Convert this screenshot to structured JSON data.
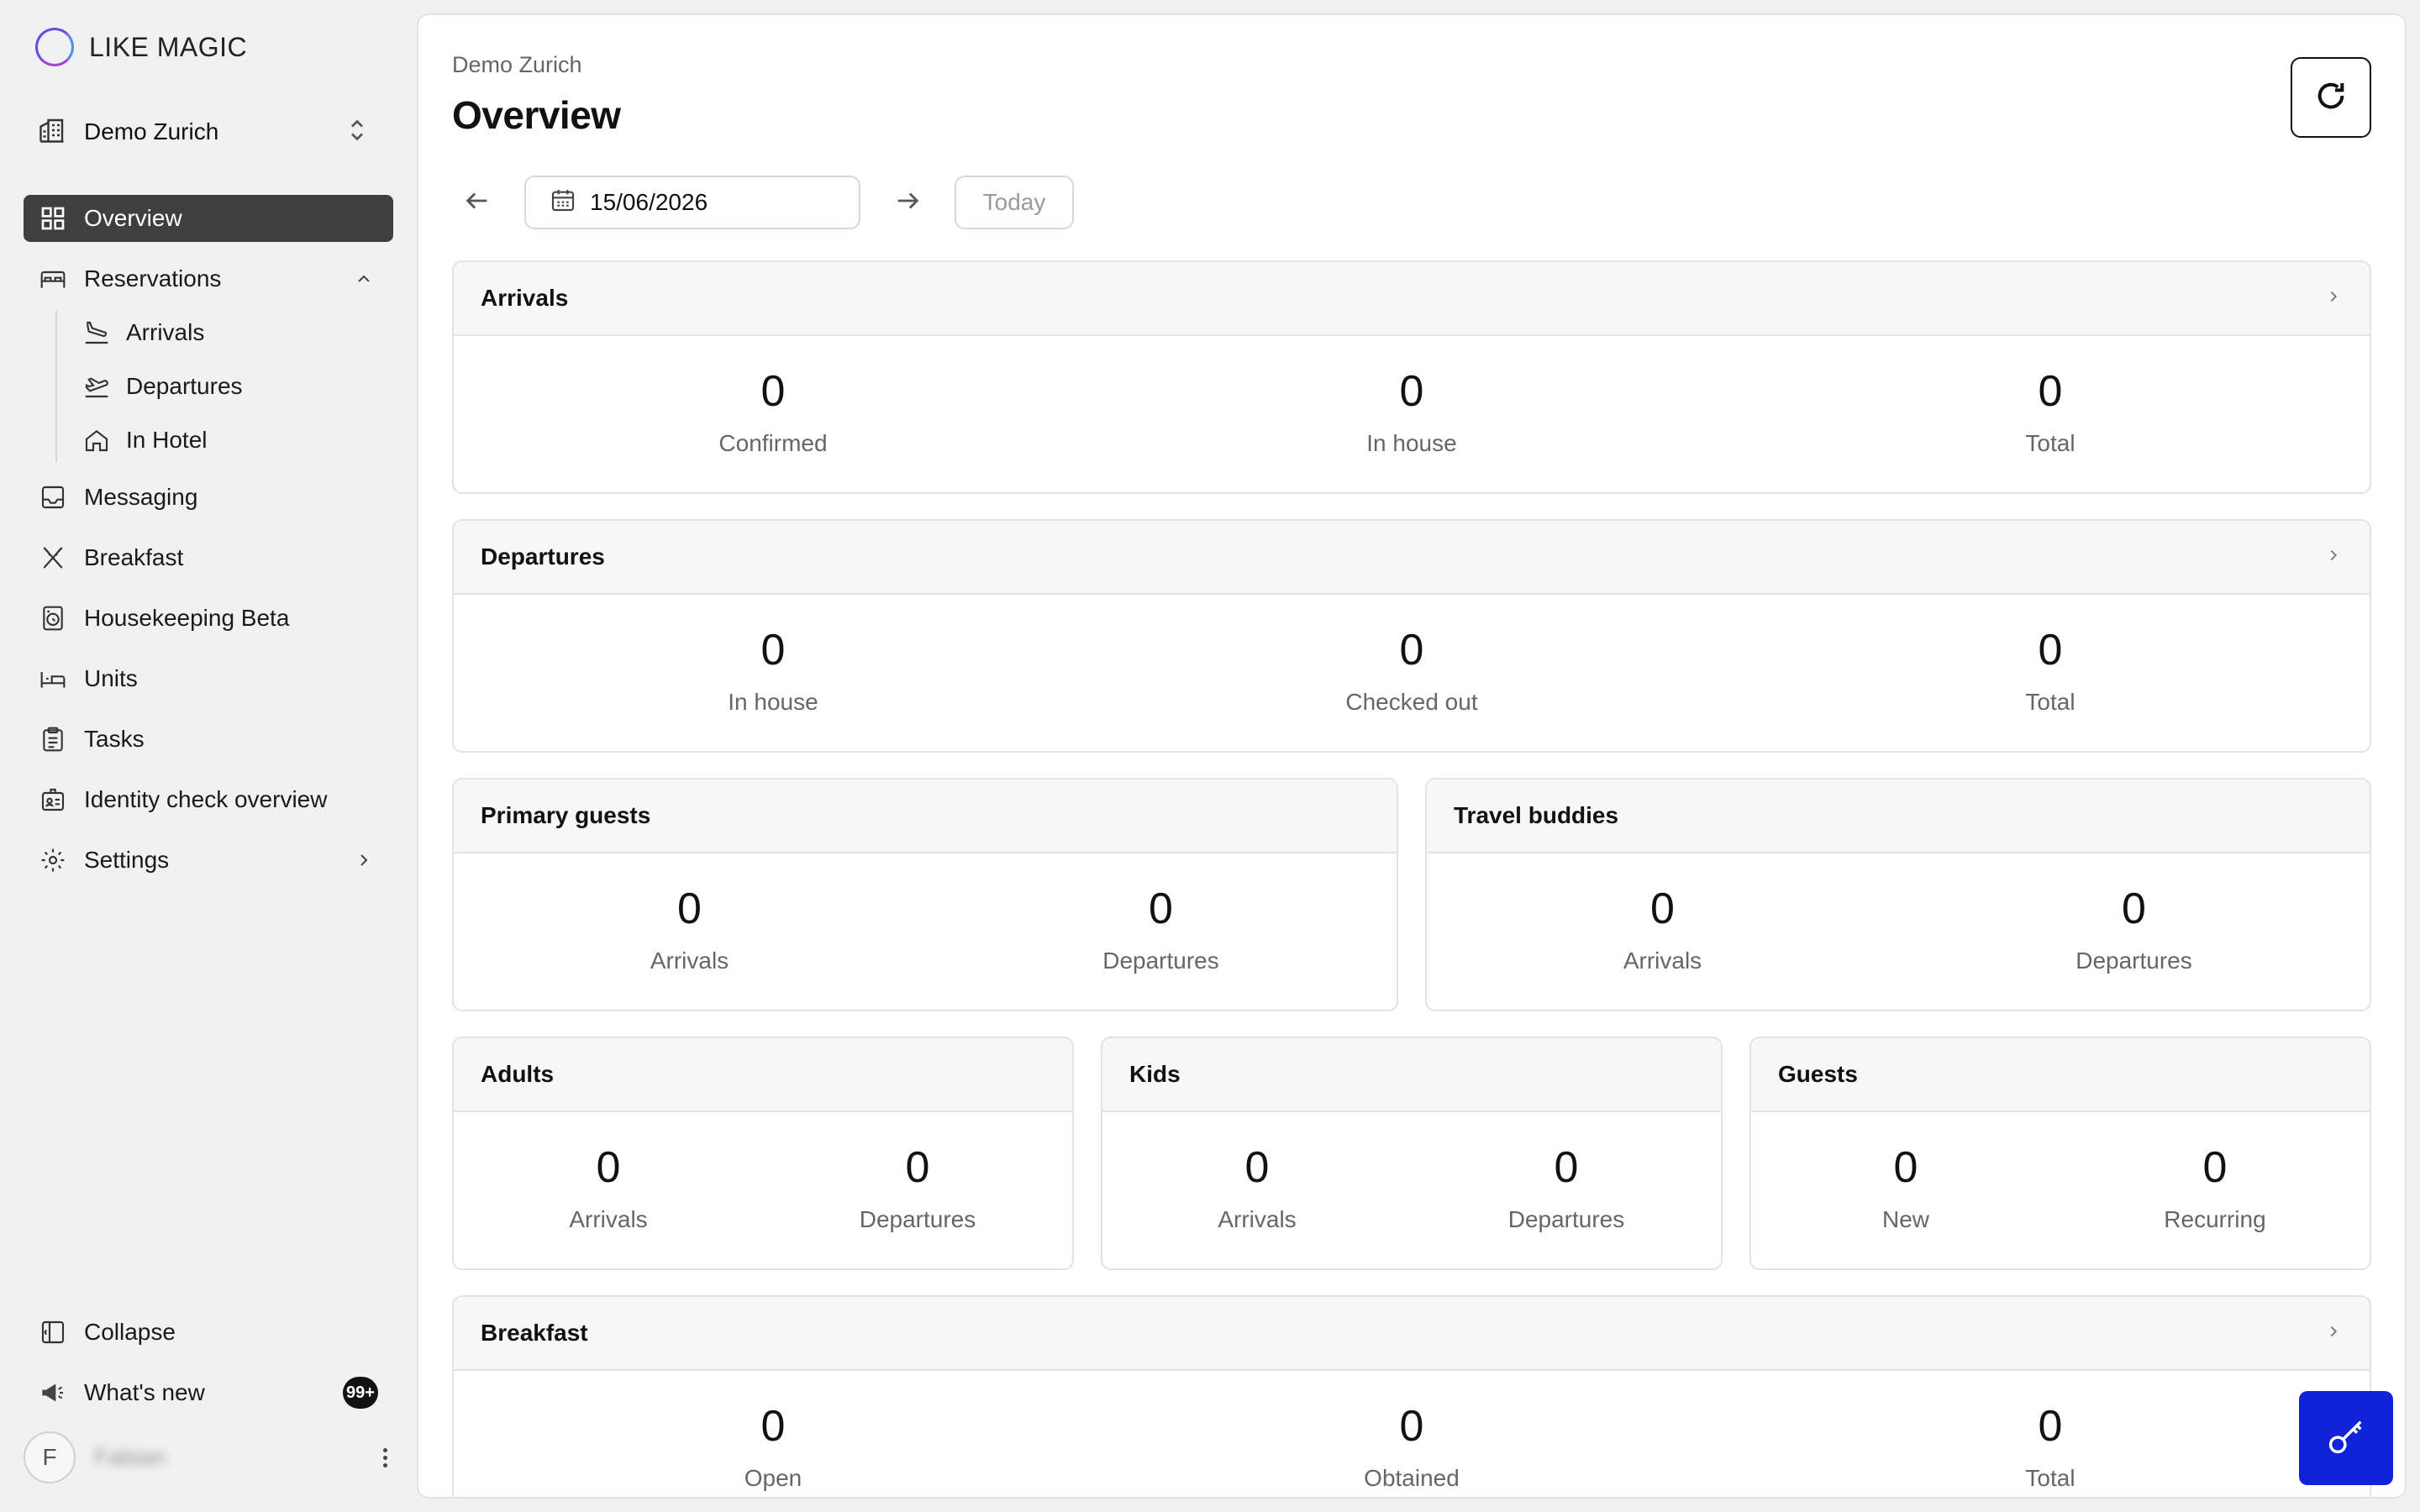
{
  "app": {
    "name": "LIKE MAGIC"
  },
  "property": {
    "name": "Demo Zurich"
  },
  "nav": {
    "overview": "Overview",
    "reservations": "Reservations",
    "arrivals": "Arrivals",
    "departures": "Departures",
    "in_hotel": "In Hotel",
    "messaging": "Messaging",
    "breakfast": "Breakfast",
    "housekeeping": "Housekeeping Beta",
    "units": "Units",
    "tasks": "Tasks",
    "identity": "Identity check overview",
    "settings": "Settings"
  },
  "bottom": {
    "collapse": "Collapse",
    "whats_new": "What's new",
    "badge": "99+",
    "avatar_initial": "F",
    "user_name": "Fabian"
  },
  "header": {
    "breadcrumb": "Demo Zurich",
    "title": "Overview"
  },
  "datebar": {
    "date": "15/06/2026",
    "today": "Today"
  },
  "cards": {
    "arrivals": {
      "title": "Arrivals",
      "stats": [
        {
          "value": "0",
          "label": "Confirmed"
        },
        {
          "value": "0",
          "label": "In house"
        },
        {
          "value": "0",
          "label": "Total"
        }
      ]
    },
    "departures": {
      "title": "Departures",
      "stats": [
        {
          "value": "0",
          "label": "In house"
        },
        {
          "value": "0",
          "label": "Checked out"
        },
        {
          "value": "0",
          "label": "Total"
        }
      ]
    },
    "primary_guests": {
      "title": "Primary guests",
      "stats": [
        {
          "value": "0",
          "label": "Arrivals"
        },
        {
          "value": "0",
          "label": "Departures"
        }
      ]
    },
    "travel_buddies": {
      "title": "Travel buddies",
      "stats": [
        {
          "value": "0",
          "label": "Arrivals"
        },
        {
          "value": "0",
          "label": "Departures"
        }
      ]
    },
    "adults": {
      "title": "Adults",
      "stats": [
        {
          "value": "0",
          "label": "Arrivals"
        },
        {
          "value": "0",
          "label": "Departures"
        }
      ]
    },
    "kids": {
      "title": "Kids",
      "stats": [
        {
          "value": "0",
          "label": "Arrivals"
        },
        {
          "value": "0",
          "label": "Departures"
        }
      ]
    },
    "guests": {
      "title": "Guests",
      "stats": [
        {
          "value": "0",
          "label": "New"
        },
        {
          "value": "0",
          "label": "Recurring"
        }
      ]
    },
    "breakfast": {
      "title": "Breakfast",
      "stats": [
        {
          "value": "0",
          "label": "Open"
        },
        {
          "value": "0",
          "label": "Obtained"
        },
        {
          "value": "0",
          "label": "Total"
        }
      ]
    }
  },
  "colors": {
    "accent": "#0f24d8",
    "active_nav": "#3f3f3f",
    "background": "#f1f1f1"
  },
  "icons": [
    "building-icon",
    "grid-icon",
    "bed-icon",
    "plane-landing-icon",
    "plane-takeoff-icon",
    "home-icon",
    "inbox-icon",
    "utensils-icon",
    "washing-machine-icon",
    "bed-frame-icon",
    "clipboard-icon",
    "id-card-icon",
    "gear-icon",
    "sidebar-icon",
    "megaphone-icon",
    "refresh-icon",
    "calendar-icon",
    "key-icon"
  ]
}
